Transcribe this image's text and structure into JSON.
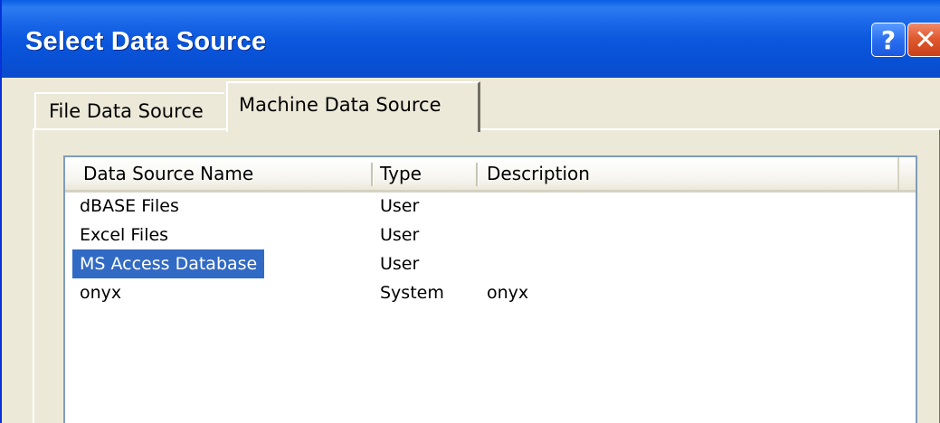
{
  "window": {
    "title": "Select Data Source",
    "help_glyph": "?",
    "close_glyph": "✕",
    "colors": {
      "titlebar": "#0a56dc",
      "selection": "#316ac5",
      "close_button": "#e05a30",
      "face": "#ece9d8"
    }
  },
  "tabs": [
    {
      "label": "File Data Source",
      "active": false
    },
    {
      "label": "Machine Data Source",
      "active": true
    }
  ],
  "list": {
    "columns": [
      "Data Source Name",
      "Type",
      "Description"
    ],
    "rows": [
      {
        "name": "dBASE Files",
        "type": "User",
        "description": ""
      },
      {
        "name": "Excel Files",
        "type": "User",
        "description": ""
      },
      {
        "name": "MS Access Database",
        "type": "User",
        "description": "",
        "selected": true
      },
      {
        "name": "onyx",
        "type": "System",
        "description": "onyx"
      }
    ]
  }
}
